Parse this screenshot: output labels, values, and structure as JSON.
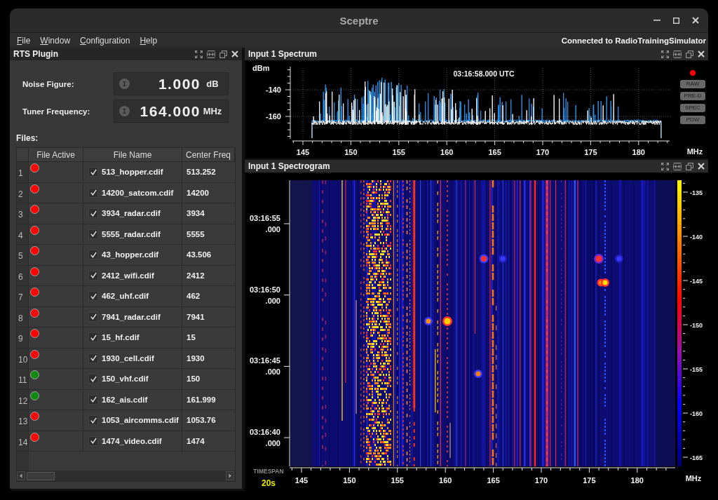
{
  "window": {
    "title": "Sceptre"
  },
  "menu": [
    {
      "label": "File"
    },
    {
      "label": "Window"
    },
    {
      "label": "Configuration"
    },
    {
      "label": "Help"
    }
  ],
  "connection_status": "Connected to RadioTrainingSimulator",
  "rts_plugin": {
    "title": "RTS Plugin",
    "parameters": [
      {
        "label": "Noise Figure:",
        "value": "1.000",
        "unit": "dB"
      },
      {
        "label": "Tuner Frequency:",
        "value": "164.000",
        "unit": "MHz"
      }
    ],
    "files_label": "Files:",
    "table": {
      "columns": [
        "File Active",
        "File Name",
        "Center Freq"
      ],
      "rows": [
        {
          "index": "1",
          "color": "#ff0000",
          "checked": true,
          "file_name": "513_hopper.cdif",
          "center_freq": "513.252"
        },
        {
          "index": "2",
          "color": "#ff0000",
          "checked": true,
          "file_name": "14200_satcom.cdif",
          "center_freq": "14200"
        },
        {
          "index": "3",
          "color": "#ff0000",
          "checked": true,
          "file_name": "3934_radar.cdif",
          "center_freq": "3934"
        },
        {
          "index": "4",
          "color": "#ff0000",
          "checked": true,
          "file_name": "5555_radar.cdif",
          "center_freq": "5555"
        },
        {
          "index": "5",
          "color": "#ff0000",
          "checked": true,
          "file_name": "43_hopper.cdif",
          "center_freq": "43.506"
        },
        {
          "index": "6",
          "color": "#ff0000",
          "checked": true,
          "file_name": "2412_wifi.cdif",
          "center_freq": "2412"
        },
        {
          "index": "7",
          "color": "#ff0000",
          "checked": true,
          "file_name": "462_uhf.cdif",
          "center_freq": "462"
        },
        {
          "index": "8",
          "color": "#ff0000",
          "checked": true,
          "file_name": "7941_radar.cdif",
          "center_freq": "7941"
        },
        {
          "index": "9",
          "color": "#ff0000",
          "checked": true,
          "file_name": "15_hf.cdif",
          "center_freq": "15"
        },
        {
          "index": "10",
          "color": "#ff0000",
          "checked": true,
          "file_name": "1930_cell.cdif",
          "center_freq": "1930"
        },
        {
          "index": "11",
          "color": "#118a11",
          "checked": true,
          "file_name": "150_vhf.cdif",
          "center_freq": "150"
        },
        {
          "index": "12",
          "color": "#118a11",
          "checked": true,
          "file_name": "162_ais.cdif",
          "center_freq": "161.999"
        },
        {
          "index": "13",
          "color": "#ff0000",
          "checked": true,
          "file_name": "1053_aircomms.cdif",
          "center_freq": "1053.76"
        },
        {
          "index": "14",
          "color": "#ff0000",
          "checked": true,
          "file_name": "1474_video.cdif",
          "center_freq": "1474"
        }
      ]
    }
  },
  "spectrum": {
    "title": "Input 1 Spectrum",
    "y_unit": "dBm",
    "timestamp": "03:16:58.000 UTC",
    "y_ticks": [
      "-140",
      "-160"
    ],
    "x_ticks": [
      "145",
      "150",
      "155",
      "160",
      "165",
      "170",
      "175",
      "180"
    ],
    "x_unit": "MHz",
    "buttons": [
      "RAW",
      "PRE-D",
      "SPEC",
      "PDW"
    ]
  },
  "spectrogram": {
    "title": "Input 1 Spectrogram",
    "time_labels": [
      {
        "time": "03:16:55",
        "fraction": ".000"
      },
      {
        "time": "03:16:50",
        "fraction": ".000"
      },
      {
        "time": "03:16:45",
        "fraction": ".000"
      },
      {
        "time": "03:16:40",
        "fraction": ".000"
      }
    ],
    "timespan_label": "TIMESPAN",
    "timespan": "20s",
    "x_ticks": [
      "145",
      "150",
      "155",
      "160",
      "165",
      "170",
      "175",
      "180"
    ],
    "x_unit": "MHz",
    "scale_ticks": [
      "-135",
      "-140",
      "-145",
      "-150",
      "-155",
      "-160",
      "-165"
    ]
  }
}
